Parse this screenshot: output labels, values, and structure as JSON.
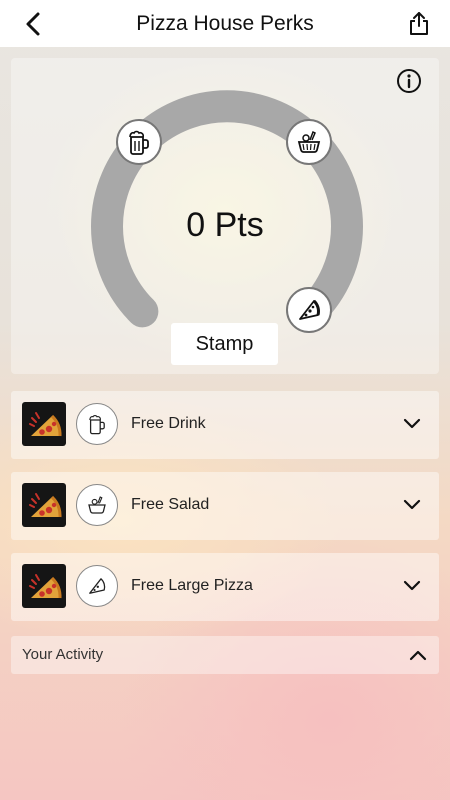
{
  "header": {
    "title": "Pizza House Perks"
  },
  "stamp_card": {
    "points_label": "0 Pts",
    "stamp_button_label": "Stamp",
    "progress_fraction": 0
  },
  "rewards": [
    {
      "label": "Free Drink",
      "icon": "beer-mug-icon"
    },
    {
      "label": "Free Salad",
      "icon": "salad-bowl-icon"
    },
    {
      "label": "Free Large Pizza",
      "icon": "pizza-slice-icon"
    }
  ],
  "activity": {
    "label": "Your Activity"
  },
  "colors": {
    "gauge_track": "#a8a8a8",
    "header_bg": "#ffffff"
  }
}
